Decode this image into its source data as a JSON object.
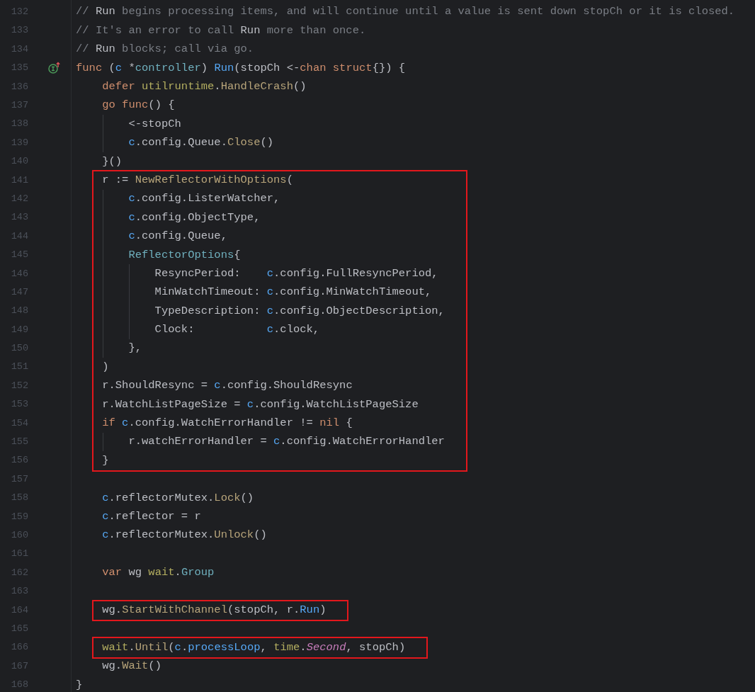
{
  "editor": {
    "blocks": [
      {
        "boxed": false,
        "lines": [
          {
            "number": "132",
            "tokens": [
              {
                "text": "// ",
                "kind": "comment"
              },
              {
                "text": "Run",
                "kind": "comment_ref"
              },
              {
                "text": " begins processing items, and will continue until a value is sent down stopCh or it is closed.",
                "kind": "comment"
              }
            ]
          },
          {
            "number": "133",
            "tokens": [
              {
                "text": "// It's an error to call ",
                "kind": "comment"
              },
              {
                "text": "Run",
                "kind": "comment_ref"
              },
              {
                "text": " more than once.",
                "kind": "comment"
              }
            ]
          },
          {
            "number": "134",
            "tokens": [
              {
                "text": "// ",
                "kind": "comment"
              },
              {
                "text": "Run",
                "kind": "comment_ref"
              },
              {
                "text": " blocks; call via go.",
                "kind": "comment"
              }
            ]
          },
          {
            "number": "135",
            "implemented": true,
            "tokens": [
              {
                "text": "func",
                "kind": "keyword"
              },
              {
                "text": " (",
                "kind": "plain"
              },
              {
                "text": "c",
                "kind": "param"
              },
              {
                "text": " *",
                "kind": "plain"
              },
              {
                "text": "controller",
                "kind": "type"
              },
              {
                "text": ") ",
                "kind": "plain"
              },
              {
                "text": "Run",
                "kind": "fn_decl"
              },
              {
                "text": "(stopCh <-",
                "kind": "plain"
              },
              {
                "text": "chan",
                "kind": "keyword"
              },
              {
                "text": " struct",
                "kind": "keyword"
              },
              {
                "text": "{}) {",
                "kind": "plain"
              }
            ]
          },
          {
            "number": "136",
            "tokens": [
              {
                "text": "    defer",
                "kind": "keyword"
              },
              {
                "text": " utilruntime",
                "kind": "package"
              },
              {
                "text": ".",
                "kind": "plain"
              },
              {
                "text": "HandleCrash",
                "kind": "method"
              },
              {
                "text": "()",
                "kind": "plain"
              }
            ]
          },
          {
            "number": "137",
            "tokens": [
              {
                "text": "    go",
                "kind": "keyword"
              },
              {
                "text": " func",
                "kind": "keyword"
              },
              {
                "text": "() {",
                "kind": "plain"
              }
            ]
          },
          {
            "number": "138",
            "tokens": [
              {
                "text": "        <-stopCh",
                "kind": "plain"
              }
            ]
          },
          {
            "number": "139",
            "tokens": [
              {
                "text": "        c",
                "kind": "param"
              },
              {
                "text": ".config.Queue.",
                "kind": "plain"
              },
              {
                "text": "Close",
                "kind": "method"
              },
              {
                "text": "()",
                "kind": "plain"
              }
            ]
          },
          {
            "number": "140",
            "tokens": [
              {
                "text": "    }()",
                "kind": "plain"
              }
            ]
          }
        ]
      },
      {
        "boxed": true,
        "lines": [
          {
            "number": "141",
            "tokens": [
              {
                "text": "    r := ",
                "kind": "plain"
              },
              {
                "text": "NewReflectorWithOptions",
                "kind": "method"
              },
              {
                "text": "(",
                "kind": "plain"
              }
            ]
          },
          {
            "number": "142",
            "tokens": [
              {
                "text": "        c",
                "kind": "param"
              },
              {
                "text": ".config.ListerWatcher,",
                "kind": "plain"
              }
            ]
          },
          {
            "number": "143",
            "tokens": [
              {
                "text": "        c",
                "kind": "param"
              },
              {
                "text": ".config.ObjectType,",
                "kind": "plain"
              }
            ]
          },
          {
            "number": "144",
            "tokens": [
              {
                "text": "        c",
                "kind": "param"
              },
              {
                "text": ".config.Queue,",
                "kind": "plain"
              }
            ]
          },
          {
            "number": "145",
            "tokens": [
              {
                "text": "        ReflectorOptions",
                "kind": "type"
              },
              {
                "text": "{",
                "kind": "plain"
              }
            ]
          },
          {
            "number": "146",
            "tokens": [
              {
                "text": "            ResyncPeriod:    ",
                "kind": "plain"
              },
              {
                "text": "c",
                "kind": "param"
              },
              {
                "text": ".config.FullResyncPeriod,",
                "kind": "plain"
              }
            ]
          },
          {
            "number": "147",
            "tokens": [
              {
                "text": "            MinWatchTimeout: ",
                "kind": "plain"
              },
              {
                "text": "c",
                "kind": "param"
              },
              {
                "text": ".config.MinWatchTimeout,",
                "kind": "plain"
              }
            ]
          },
          {
            "number": "148",
            "tokens": [
              {
                "text": "            TypeDescription: ",
                "kind": "plain"
              },
              {
                "text": "c",
                "kind": "param"
              },
              {
                "text": ".config.ObjectDescription,",
                "kind": "plain"
              }
            ]
          },
          {
            "number": "149",
            "tokens": [
              {
                "text": "            Clock:           ",
                "kind": "plain"
              },
              {
                "text": "c",
                "kind": "param"
              },
              {
                "text": ".clock,",
                "kind": "plain"
              }
            ]
          },
          {
            "number": "150",
            "tokens": [
              {
                "text": "        },",
                "kind": "plain"
              }
            ]
          },
          {
            "number": "151",
            "tokens": [
              {
                "text": "    )",
                "kind": "plain"
              }
            ]
          },
          {
            "number": "152",
            "tokens": [
              {
                "text": "    r.ShouldResync = ",
                "kind": "plain"
              },
              {
                "text": "c",
                "kind": "param"
              },
              {
                "text": ".config.ShouldResync",
                "kind": "plain"
              }
            ]
          },
          {
            "number": "153",
            "tokens": [
              {
                "text": "    r.WatchListPageSize = ",
                "kind": "plain"
              },
              {
                "text": "c",
                "kind": "param"
              },
              {
                "text": ".config.WatchListPageSize",
                "kind": "plain"
              }
            ]
          },
          {
            "number": "154",
            "tokens": [
              {
                "text": "    if",
                "kind": "keyword"
              },
              {
                "text": " c",
                "kind": "param"
              },
              {
                "text": ".config.WatchErrorHandler != ",
                "kind": "plain"
              },
              {
                "text": "nil",
                "kind": "keyword"
              },
              {
                "text": " {",
                "kind": "plain"
              }
            ]
          },
          {
            "number": "155",
            "tokens": [
              {
                "text": "        r.watchErrorHandler = ",
                "kind": "plain"
              },
              {
                "text": "c",
                "kind": "param"
              },
              {
                "text": ".config.WatchErrorHandler",
                "kind": "plain"
              }
            ]
          },
          {
            "number": "156",
            "tokens": [
              {
                "text": "    }",
                "kind": "plain"
              }
            ]
          }
        ]
      },
      {
        "boxed": false,
        "lines": [
          {
            "number": "157"
          },
          {
            "number": "158",
            "tokens": [
              {
                "text": "    c",
                "kind": "param"
              },
              {
                "text": ".reflectorMutex.",
                "kind": "plain"
              },
              {
                "text": "Lock",
                "kind": "method"
              },
              {
                "text": "()",
                "kind": "plain"
              }
            ]
          },
          {
            "number": "159",
            "tokens": [
              {
                "text": "    c",
                "kind": "param"
              },
              {
                "text": ".reflector = r",
                "kind": "plain"
              }
            ]
          },
          {
            "number": "160",
            "tokens": [
              {
                "text": "    c",
                "kind": "param"
              },
              {
                "text": ".reflectorMutex.",
                "kind": "plain"
              },
              {
                "text": "Unlock",
                "kind": "method"
              },
              {
                "text": "()",
                "kind": "plain"
              }
            ]
          },
          {
            "number": "161"
          },
          {
            "number": "162",
            "tokens": [
              {
                "text": "    var",
                "kind": "keyword"
              },
              {
                "text": " wg ",
                "kind": "plain"
              },
              {
                "text": "wait",
                "kind": "package"
              },
              {
                "text": ".",
                "kind": "plain"
              },
              {
                "text": "Group",
                "kind": "type"
              }
            ]
          },
          {
            "number": "163"
          }
        ]
      },
      {
        "boxed": true,
        "lines": [
          {
            "number": "164",
            "tokens": [
              {
                "text": "    wg.",
                "kind": "plain"
              },
              {
                "text": "StartWithChannel",
                "kind": "method"
              },
              {
                "text": "(stopCh, r.",
                "kind": "plain"
              },
              {
                "text": "Run",
                "kind": "fn_ref"
              },
              {
                "text": ")",
                "kind": "plain"
              }
            ]
          }
        ]
      },
      {
        "boxed": false,
        "lines": [
          {
            "number": "165"
          }
        ]
      },
      {
        "boxed": true,
        "lines": [
          {
            "number": "166",
            "tokens": [
              {
                "text": "    wait",
                "kind": "package"
              },
              {
                "text": ".",
                "kind": "plain"
              },
              {
                "text": "Until",
                "kind": "method"
              },
              {
                "text": "(",
                "kind": "plain"
              },
              {
                "text": "c",
                "kind": "param"
              },
              {
                "text": ".",
                "kind": "plain"
              },
              {
                "text": "processLoop",
                "kind": "fn_ref"
              },
              {
                "text": ", ",
                "kind": "plain"
              },
              {
                "text": "time",
                "kind": "package"
              },
              {
                "text": ".",
                "kind": "plain"
              },
              {
                "text": "Second",
                "kind": "constant"
              },
              {
                "text": ", stopCh)",
                "kind": "plain"
              }
            ]
          }
        ]
      },
      {
        "boxed": false,
        "lines": [
          {
            "number": "167",
            "tokens": [
              {
                "text": "    wg.",
                "kind": "plain"
              },
              {
                "text": "Wait",
                "kind": "method"
              },
              {
                "text": "()",
                "kind": "plain"
              }
            ]
          },
          {
            "number": "168",
            "tokens": [
              {
                "text": "}",
                "kind": "plain"
              }
            ]
          }
        ]
      }
    ]
  }
}
